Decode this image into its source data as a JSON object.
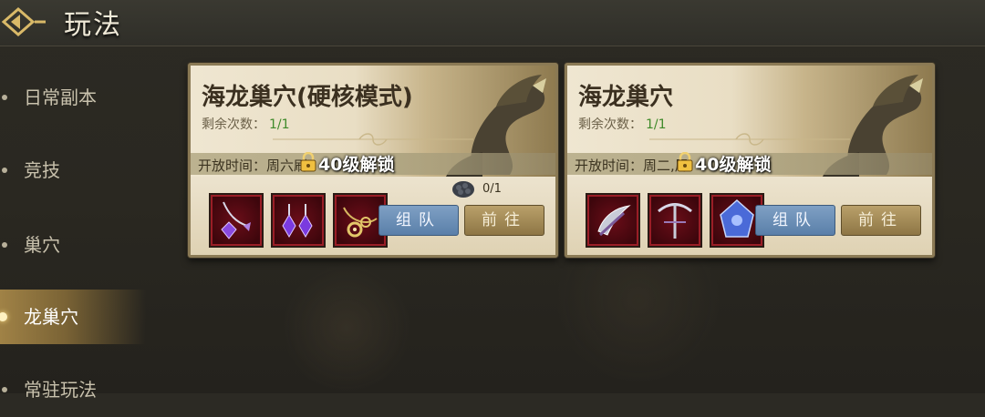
{
  "header": {
    "title": "玩法"
  },
  "sidebar": {
    "items": [
      {
        "label": "日常副本",
        "active": false
      },
      {
        "label": "竞技",
        "active": false
      },
      {
        "label": "巢穴",
        "active": false
      },
      {
        "label": "龙巢穴",
        "active": true
      },
      {
        "label": "常驻玩法",
        "active": false
      }
    ]
  },
  "cards": [
    {
      "name": "海龙巢穴(硬核模式)",
      "tries_label": "剩余次数：",
      "tries_value": "1/1",
      "open_time": "开放时间：周六刷",
      "lock_text": "40级解锁",
      "stone_count": "0/1",
      "team_label": "组队",
      "go_label": "前往",
      "items": [
        "amethyst-necklace-icon",
        "amethyst-earrings-icon",
        "gold-necklace-icon"
      ]
    },
    {
      "name": "海龙巢穴",
      "tries_label": "剩余次数：",
      "tries_value": "1/1",
      "open_time": "开放时间：周二,周",
      "lock_text": "40级解锁",
      "team_label": "组队",
      "go_label": "前往",
      "items": [
        "crescent-blade-icon",
        "crossbow-icon",
        "blue-relic-icon"
      ]
    }
  ],
  "colors": {
    "accent_gold": "#a08246",
    "item_slot_red": "#6a0d18",
    "tries_green": "#3f8a2a",
    "team_blue": "#5a7fa9"
  }
}
